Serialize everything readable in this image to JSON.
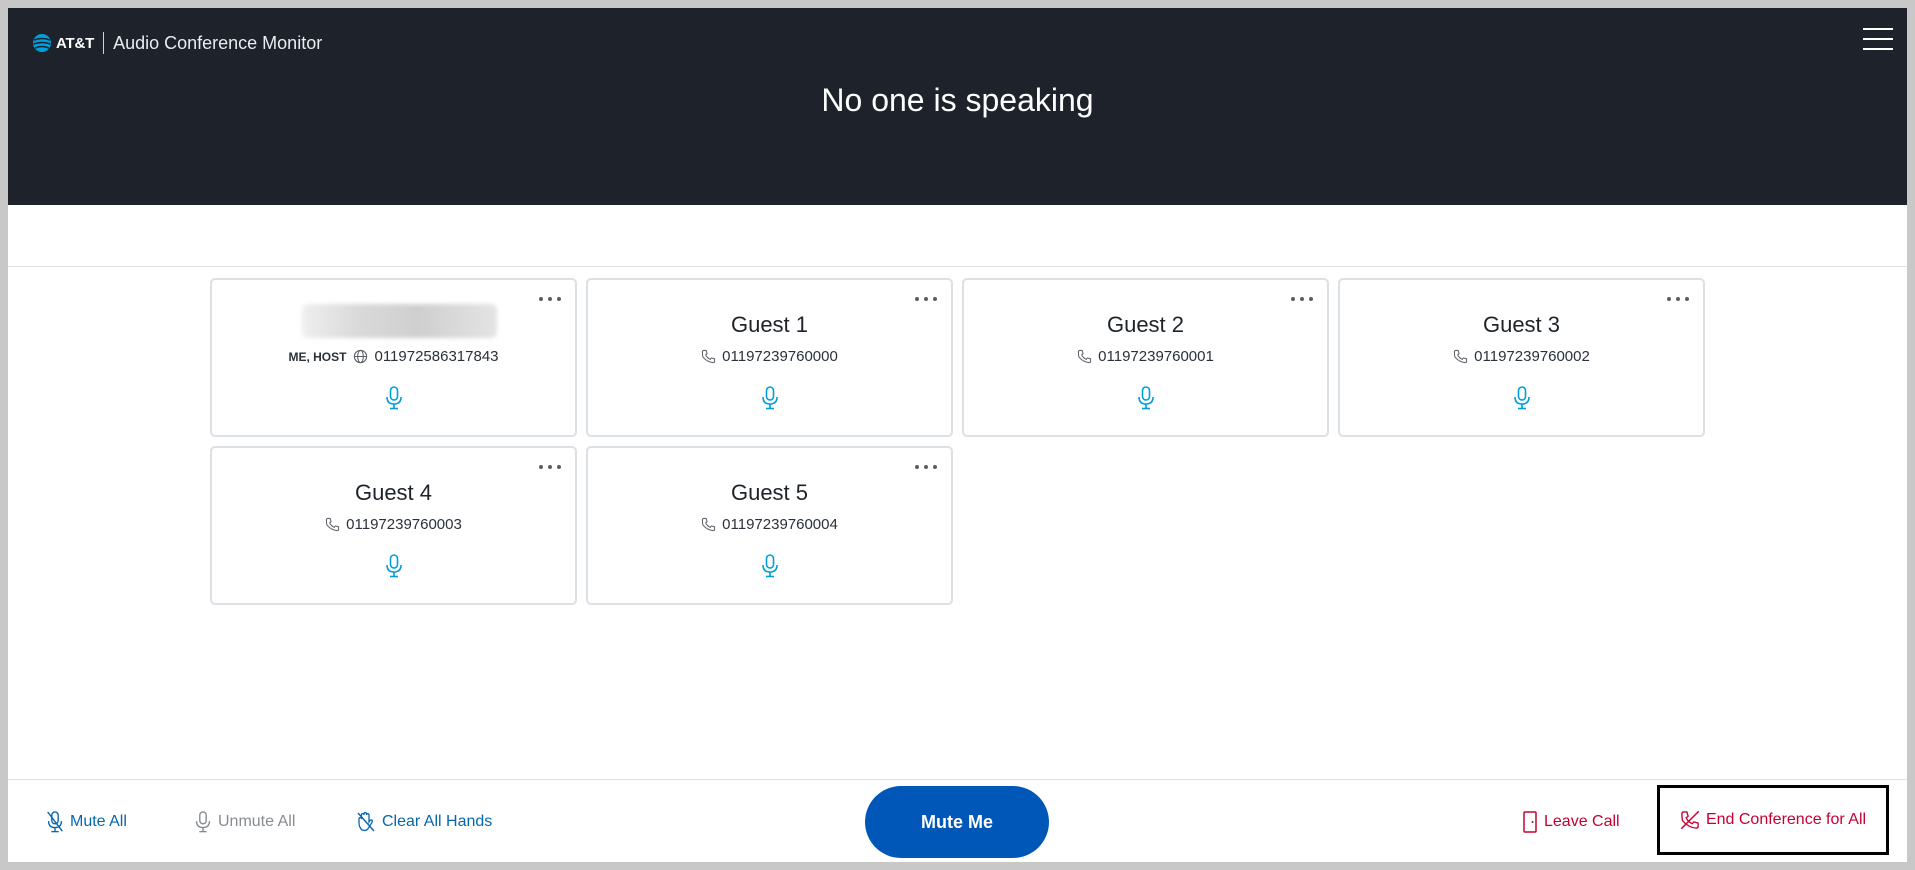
{
  "header": {
    "logo_text": "AT&T",
    "app_title": "Audio Conference Monitor",
    "speaking_status": "No one is speaking"
  },
  "participants": [
    {
      "name": "",
      "role": "ME, HOST",
      "connection_icon": "globe-icon",
      "number": "011972586317843",
      "name_blurred": true
    },
    {
      "name": "Guest 1",
      "connection_icon": "phone-icon",
      "number": "01197239760000"
    },
    {
      "name": "Guest 2",
      "connection_icon": "phone-icon",
      "number": "01197239760001"
    },
    {
      "name": "Guest 3",
      "connection_icon": "phone-icon",
      "number": "01197239760002"
    },
    {
      "name": "Guest 4",
      "connection_icon": "phone-icon",
      "number": "01197239760003"
    },
    {
      "name": "Guest 5",
      "connection_icon": "phone-icon",
      "number": "01197239760004"
    }
  ],
  "footer": {
    "mute_all": "Mute All",
    "unmute_all": "Unmute All",
    "clear_all_hands": "Clear All Hands",
    "mute_me": "Mute Me",
    "leave_call": "Leave Call",
    "end_conference": "End Conference for All"
  },
  "colors": {
    "header_bg": "#1d222b",
    "accent_blue": "#0568ae",
    "mute_me_bg": "#0057b8",
    "danger_red": "#c70032",
    "mic_cyan": "#009fdb"
  }
}
